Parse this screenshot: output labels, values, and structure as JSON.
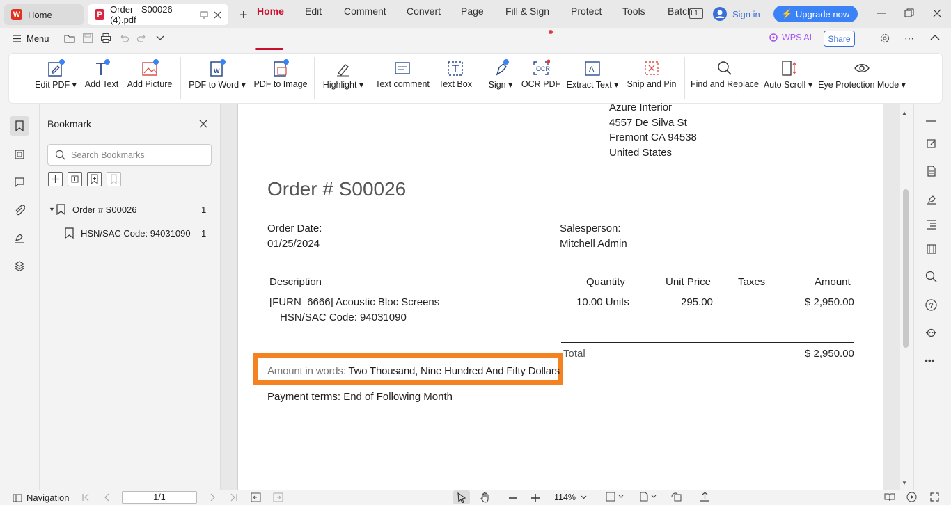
{
  "titlebar": {
    "home_tab": "Home",
    "doc_tab": "Order - S00026 (4).pdf",
    "new_tab": "+",
    "sign_in": "Sign in",
    "upgrade": "Upgrade now",
    "page_badge": "1"
  },
  "menubar": {
    "menu": "Menu",
    "tabs": [
      "Home",
      "Edit",
      "Comment",
      "Convert",
      "Page",
      "Fill & Sign",
      "Protect",
      "Tools",
      "Batch"
    ],
    "active_tab": "Home",
    "wps_ai": "WPS AI",
    "share": "Share"
  },
  "ribbon": {
    "edit_pdf": "Edit PDF",
    "add_text": "Add Text",
    "add_picture": "Add Picture",
    "pdf_to_word": "PDF to Word",
    "pdf_to_image": "PDF to Image",
    "highlight": "Highlight",
    "text_comment": "Text comment",
    "text_box": "Text Box",
    "sign": "Sign",
    "ocr_pdf": "OCR PDF",
    "extract_text": "Extract Text",
    "snip_and_pin": "Snip and Pin",
    "find_and_replace": "Find and Replace",
    "auto_scroll": "Auto Scroll",
    "eye_protection": "Eye Protection Mode"
  },
  "bookmark": {
    "title": "Bookmark",
    "search_placeholder": "Search Bookmarks",
    "items": [
      {
        "label": "Order # S00026",
        "page": "1"
      },
      {
        "label": "HSN/SAC Code: 94031090",
        "page": "1"
      }
    ]
  },
  "document": {
    "address": [
      "Azure Interior",
      "4557 De Silva St",
      "Fremont CA 94538",
      "United States"
    ],
    "order_title": "Order # S00026",
    "order_date_label": "Order Date:",
    "order_date": "01/25/2024",
    "salesperson_label": "Salesperson:",
    "salesperson": "Mitchell Admin",
    "headers": {
      "description": "Description",
      "quantity": "Quantity",
      "unit_price": "Unit Price",
      "taxes": "Taxes",
      "amount": "Amount"
    },
    "line": {
      "description": "[FURN_6666] Acoustic Bloc Screens",
      "hsn": "HSN/SAC Code: 94031090",
      "quantity": "10.00 Units",
      "unit_price": "295.00",
      "taxes": "",
      "amount": "$ 2,950.00"
    },
    "total_label": "Total",
    "total": "$ 2,950.00",
    "amount_words_label": "Amount in words:",
    "amount_words": "Two Thousand, Nine Hundred And Fifty Dollars",
    "payment_terms": "Payment terms: End of Following Month"
  },
  "statusbar": {
    "navigation": "Navigation",
    "page": "1/1",
    "zoom": "114%"
  },
  "colors": {
    "accent": "#c8102e",
    "upgrade": "#3b82f6",
    "highlight_box": "#f58220",
    "link_blue": "#3b6fd8"
  }
}
